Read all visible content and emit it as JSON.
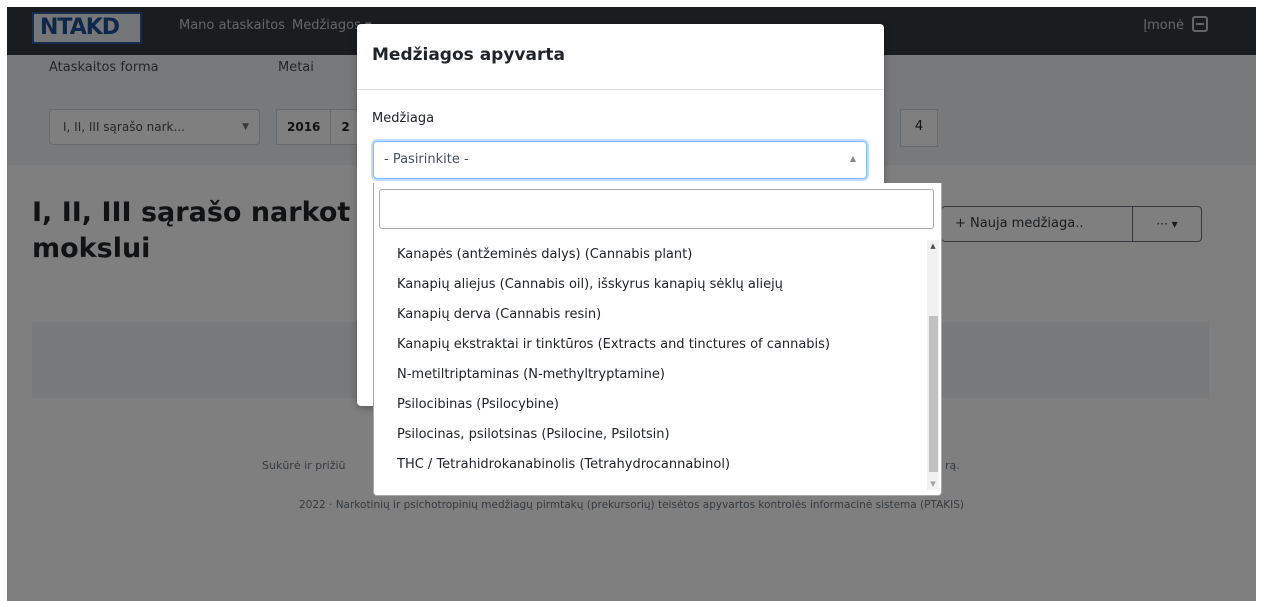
{
  "navbar": {
    "logo_text": "NTAKD",
    "link_reports": "Mano ataskaitos",
    "link_substances": "Medžiagos ▾",
    "company": "Įmonė",
    "logout_icon": "sign-out-icon"
  },
  "filters": {
    "form_label": "Ataskaitos forma",
    "form_value": "I, II, III sąrašo nark...",
    "year_label": "Metai",
    "year_selected": "2016",
    "year_next": "2",
    "quarter_value": "4"
  },
  "page": {
    "title": "I, II, III sąrašo narkot mokslui",
    "new_substance_button": "+ Nauja medžiaga..",
    "more_button": "··· ▾"
  },
  "footer": {
    "line1_left": "Sukūrė ir prižiū",
    "line1_right": "rą.",
    "line2": "2022 · Narkotinių ir psichotropinių medžiagų pirmtakų (prekursorių) teisėtos apyvartos kontrolės informacinė sistema (PTAKIS)"
  },
  "modal": {
    "title": "Medžiagos apyvarta",
    "field_label": "Medžiaga",
    "select_value": "- Pasirinkite -"
  },
  "dropdown": {
    "search_value": "",
    "items": [
      "Kanapės (antžeminės dalys) (Cannabis plant)",
      "Kanapių aliejus (Cannabis oil), išskyrus kanapių sėklų aliejų",
      "Kanapių derva (Cannabis resin)",
      "Kanapių ekstraktai ir tinktūros (Extracts and tinctures of cannabis)",
      "N-metiltriptaminas (N-methyltryptamine)",
      "Psilocibinas (Psilocybine)",
      "Psilocinas, psilotsinas (Psilocine, Psilotsin)",
      "THC / Tetrahidrokanabinolis (Tetrahydrocannabinol)"
    ]
  }
}
